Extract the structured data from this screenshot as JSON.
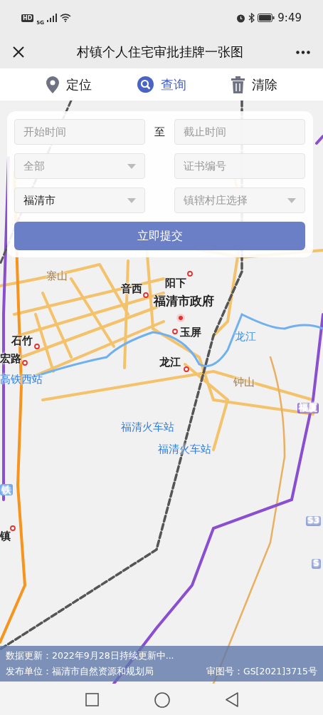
{
  "status_bar": {
    "hd_badge": "HD",
    "network": "5G",
    "time": "9:49"
  },
  "title_bar": {
    "title": "村镇个人住宅审批挂牌一张图"
  },
  "toolbar": [
    {
      "kind": "locate",
      "label": "定位",
      "selected": false
    },
    {
      "kind": "search",
      "label": "查询",
      "selected": true
    },
    {
      "kind": "clear",
      "label": "清除",
      "selected": false
    }
  ],
  "query_form": {
    "start_time": {
      "placeholder": "开始时间"
    },
    "separator": "至",
    "end_time": {
      "placeholder": "截止时间"
    },
    "type_select": {
      "placeholder": "全部"
    },
    "certificate_no": {
      "placeholder": "证书编号"
    },
    "city_select": {
      "value": "福清市"
    },
    "village_select": {
      "placeholder": "镇辖村庄选择"
    },
    "submit": "立即提交"
  },
  "map": {
    "labels": [
      {
        "kind": "area",
        "text": "寨山"
      },
      {
        "kind": "place",
        "text": "音西"
      },
      {
        "kind": "place",
        "text": "阳下"
      },
      {
        "kind": "major",
        "text": "福清市政府"
      },
      {
        "kind": "place",
        "text": "玉屏"
      },
      {
        "kind": "place",
        "text": "石竹"
      },
      {
        "kind": "place",
        "text": "宏路"
      },
      {
        "kind": "station",
        "text": "高铁西站"
      },
      {
        "kind": "water",
        "text": "龙江"
      },
      {
        "kind": "place",
        "text": "龙江"
      },
      {
        "kind": "area",
        "text": "钟山"
      },
      {
        "kind": "station",
        "text": "福清火车站"
      },
      {
        "kind": "station",
        "text": "福清火车站"
      },
      {
        "kind": "highway",
        "text": "福厦"
      },
      {
        "kind": "rail",
        "text": "铁"
      },
      {
        "kind": "road",
        "text": "S3"
      },
      {
        "kind": "road",
        "text": "S"
      },
      {
        "kind": "place",
        "text": "镇"
      }
    ]
  },
  "footer": {
    "update": "数据更新：2022年9月28日持续更新中...",
    "publisher": "发布单位：福清市自然资源和规划局",
    "approval_no": "审图号：GS[2021]3715号"
  }
}
